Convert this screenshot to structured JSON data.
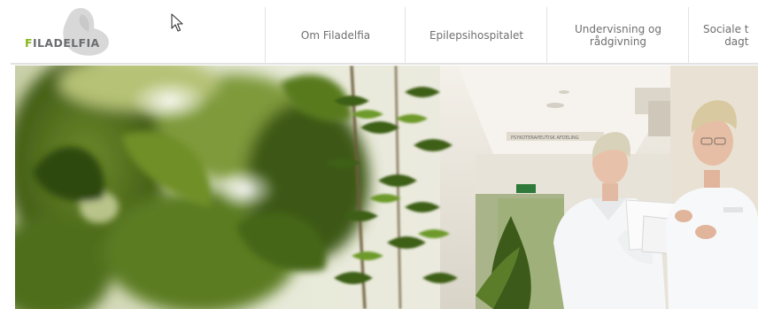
{
  "logo": {
    "text_first": "F",
    "text_rest": "ILADELFIA"
  },
  "nav": {
    "items": [
      {
        "label": "Om Filadelfia"
      },
      {
        "label": "Epilepsihospitalet"
      },
      {
        "label": "Undervisning og\nrådgivning"
      },
      {
        "label": "Sociale t\ndagt"
      }
    ]
  },
  "hero": {
    "sign_text": "PSYKOTERAPEUTISK AFDELING"
  },
  "colors": {
    "brand_green": "#8ab51f",
    "logo_gray": "#6b6e71",
    "nav_text": "#6f6f6f",
    "divider": "#e3e3e3"
  },
  "icons": [
    "cursor-icon",
    "filadelfia-logo-mark"
  ]
}
